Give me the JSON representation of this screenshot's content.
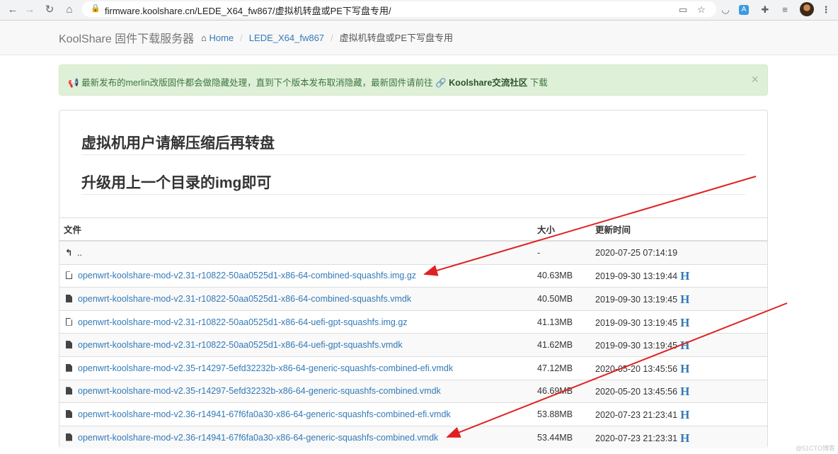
{
  "browser": {
    "url": "firmware.koolshare.cn/LEDE_X64_fw867/虚拟机转盘或PE下写盘专用/",
    "back_icon": "←",
    "forward_icon": "→",
    "reload_icon": "↻",
    "home_icon": "⌂",
    "lock_icon": "🔒",
    "menu_icon": "⋮"
  },
  "navbar": {
    "brand": "KoolShare 固件下载服务器",
    "breadcrumb": [
      {
        "label": "Home"
      },
      {
        "label": "LEDE_X64_fw867"
      },
      {
        "label": "虚拟机转盘或PE下写盘专用"
      }
    ]
  },
  "alert": {
    "text": "最新发布的merlin改版固件都会做隐藏处理，直到下个版本发布取消隐藏，最新固件请前往",
    "link": "Koolshare交流社区",
    "suffix": "下载",
    "close": "×"
  },
  "headings": {
    "line1": "虚拟机用户请解压缩后再转盘",
    "line2": "升级用上一个目录的img即可"
  },
  "table": {
    "columns": [
      "文件",
      "大小",
      "更新时间"
    ],
    "parent": {
      "name": "..",
      "size": "-",
      "time": "2020-07-25 07:14:19"
    },
    "rows": [
      {
        "name": "openwrt-koolshare-mod-v2.31-r10822-50aa0525d1-x86-64-combined-squashfs.img.gz",
        "size": "40.63MB",
        "time": "2019-09-30 13:19:44",
        "hash": "H",
        "type": "gz"
      },
      {
        "name": "openwrt-koolshare-mod-v2.31-r10822-50aa0525d1-x86-64-combined-squashfs.vmdk",
        "size": "40.50MB",
        "time": "2019-09-30 13:19:45",
        "hash": "H",
        "type": "file"
      },
      {
        "name": "openwrt-koolshare-mod-v2.31-r10822-50aa0525d1-x86-64-uefi-gpt-squashfs.img.gz",
        "size": "41.13MB",
        "time": "2019-09-30 13:19:45",
        "hash": "H",
        "type": "gz"
      },
      {
        "name": "openwrt-koolshare-mod-v2.31-r10822-50aa0525d1-x86-64-uefi-gpt-squashfs.vmdk",
        "size": "41.62MB",
        "time": "2019-09-30 13:19:45",
        "hash": "H",
        "type": "file"
      },
      {
        "name": "openwrt-koolshare-mod-v2.35-r14297-5efd32232b-x86-64-generic-squashfs-combined-efi.vmdk",
        "size": "47.12MB",
        "time": "2020-05-20 13:45:56",
        "hash": "H",
        "type": "file"
      },
      {
        "name": "openwrt-koolshare-mod-v2.35-r14297-5efd32232b-x86-64-generic-squashfs-combined.vmdk",
        "size": "46.69MB",
        "time": "2020-05-20 13:45:56",
        "hash": "H",
        "type": "file"
      },
      {
        "name": "openwrt-koolshare-mod-v2.36-r14941-67f6fa0a30-x86-64-generic-squashfs-combined-efi.vmdk",
        "size": "53.88MB",
        "time": "2020-07-23 21:23:41",
        "hash": "H",
        "type": "file"
      },
      {
        "name": "openwrt-koolshare-mod-v2.36-r14941-67f6fa0a30-x86-64-generic-squashfs-combined.vmdk",
        "size": "53.44MB",
        "time": "2020-07-23 21:23:31",
        "hash": "H",
        "type": "file"
      }
    ]
  },
  "annotation_color": "#e02020",
  "watermark": "@51CTO博客"
}
